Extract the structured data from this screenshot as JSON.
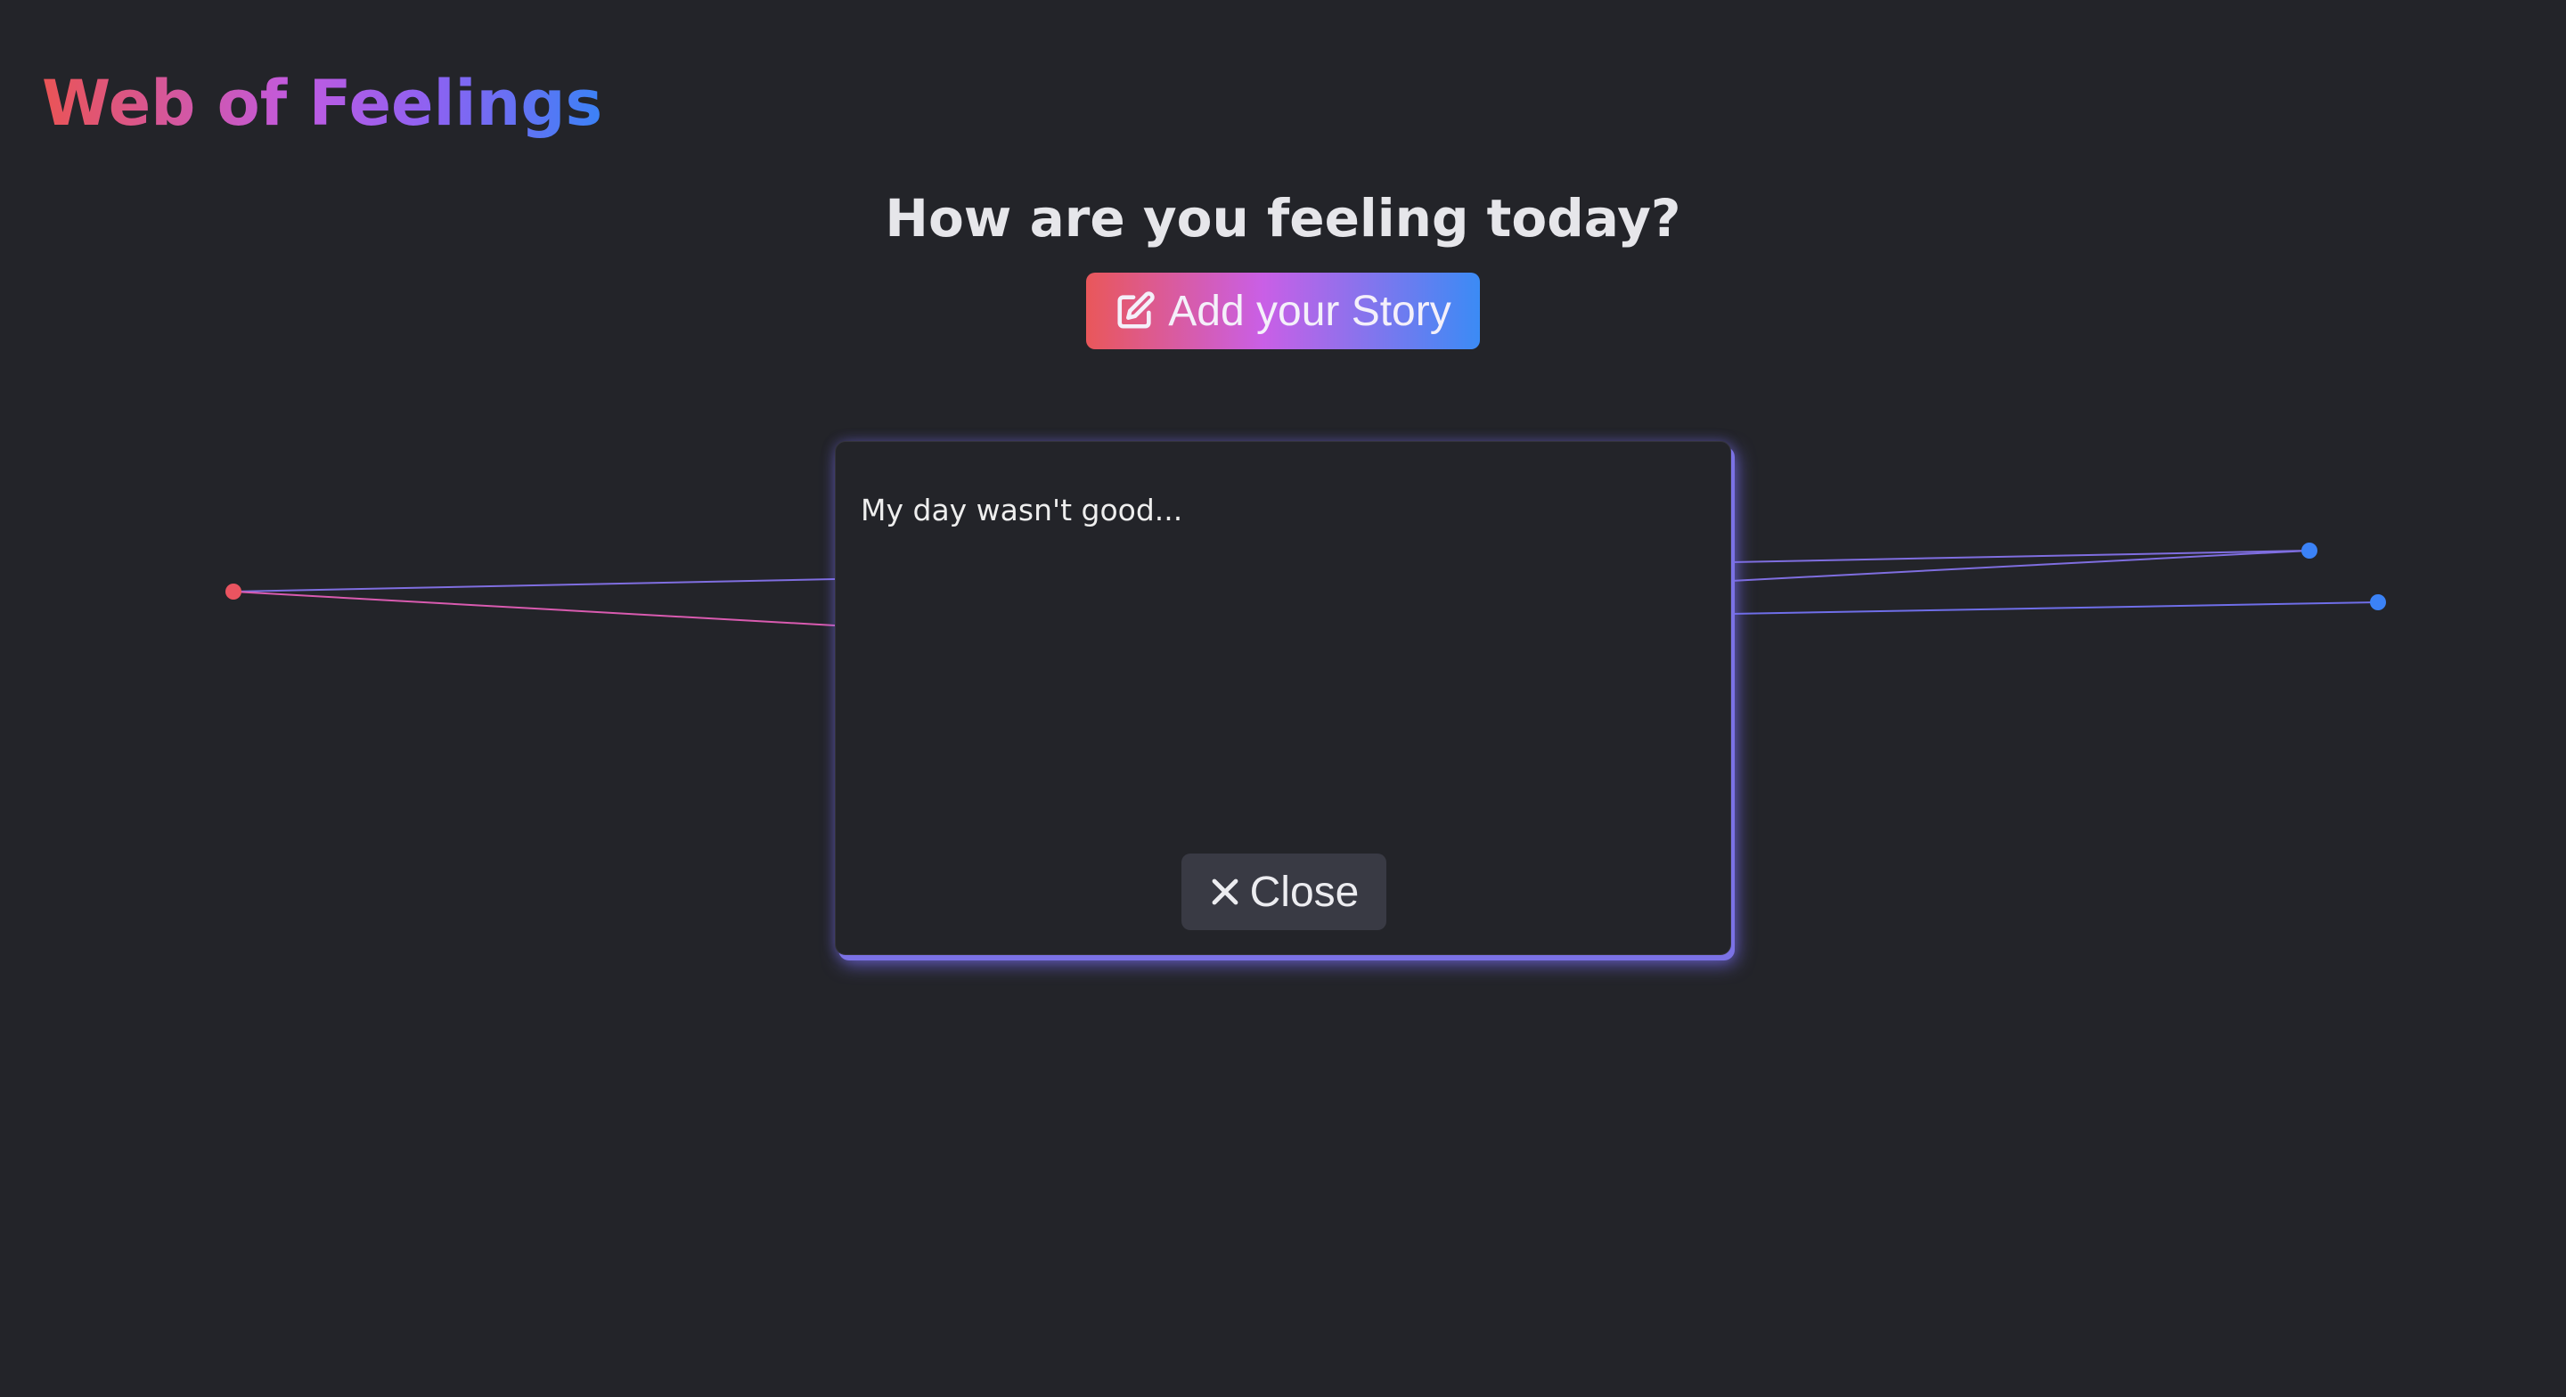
{
  "app": {
    "title": "Web of Feelings"
  },
  "main": {
    "heading": "How are you feeling today?",
    "add_story_label": "Add your Story",
    "add_story_icon": "edit-icon"
  },
  "modal": {
    "story_text": "My day wasn't good...",
    "close_label": "Close",
    "close_icon": "close-icon"
  },
  "web": {
    "node_colors": [
      "#ea5460",
      "#3b82f6",
      "#3b82f6"
    ],
    "line_colors": [
      "#7f6ee0",
      "#d95bb0"
    ]
  },
  "colors": {
    "background": "#232429",
    "accent_start": "#ea5455",
    "accent_mid": "#c15ae0",
    "accent_end": "#3b82f6",
    "modal_glow": "#7b72e6"
  }
}
